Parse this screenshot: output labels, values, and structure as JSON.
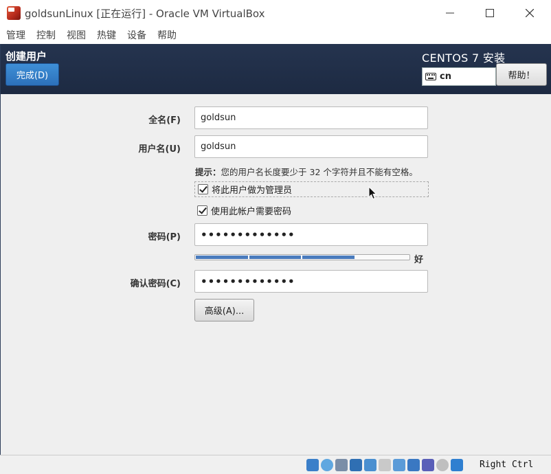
{
  "window": {
    "title": "goldsunLinux [正在运行] - Oracle VM VirtualBox"
  },
  "menu": [
    "管理",
    "控制",
    "视图",
    "热键",
    "设备",
    "帮助"
  ],
  "header": {
    "spoke_title": "创建用户",
    "done_label": "完成(D)",
    "product_title": "CENTOS 7 安装",
    "keyboard_layout": "cn",
    "help_label": "帮助！"
  },
  "form": {
    "fullname_label": "全名(F)",
    "fullname_value": "goldsun",
    "username_label": "用户名(U)",
    "username_value": "goldsun",
    "hint_prefix": "提示：",
    "hint_text": "您的用户名长度要少于 32 个字符并且不能有空格。",
    "admin_checkbox_label": "将此用户做为管理员",
    "admin_checked": true,
    "require_password_label": "使用此帐户需要密码",
    "require_password_checked": true,
    "password_label": "密码(P)",
    "password_value": "•••••••••••••",
    "strength_text": "好",
    "strength_segments_filled": 3,
    "strength_segments_total": 4,
    "confirm_label": "确认密码(C)",
    "confirm_value": "•••••••••••••",
    "advanced_label": "高级(A)..."
  },
  "statusbar": {
    "host_key": "Right Ctrl"
  },
  "colors": {
    "header_bg": "#1d2a42",
    "done_button": "#2c71bb",
    "strength_fill": "#4a7bbd"
  }
}
